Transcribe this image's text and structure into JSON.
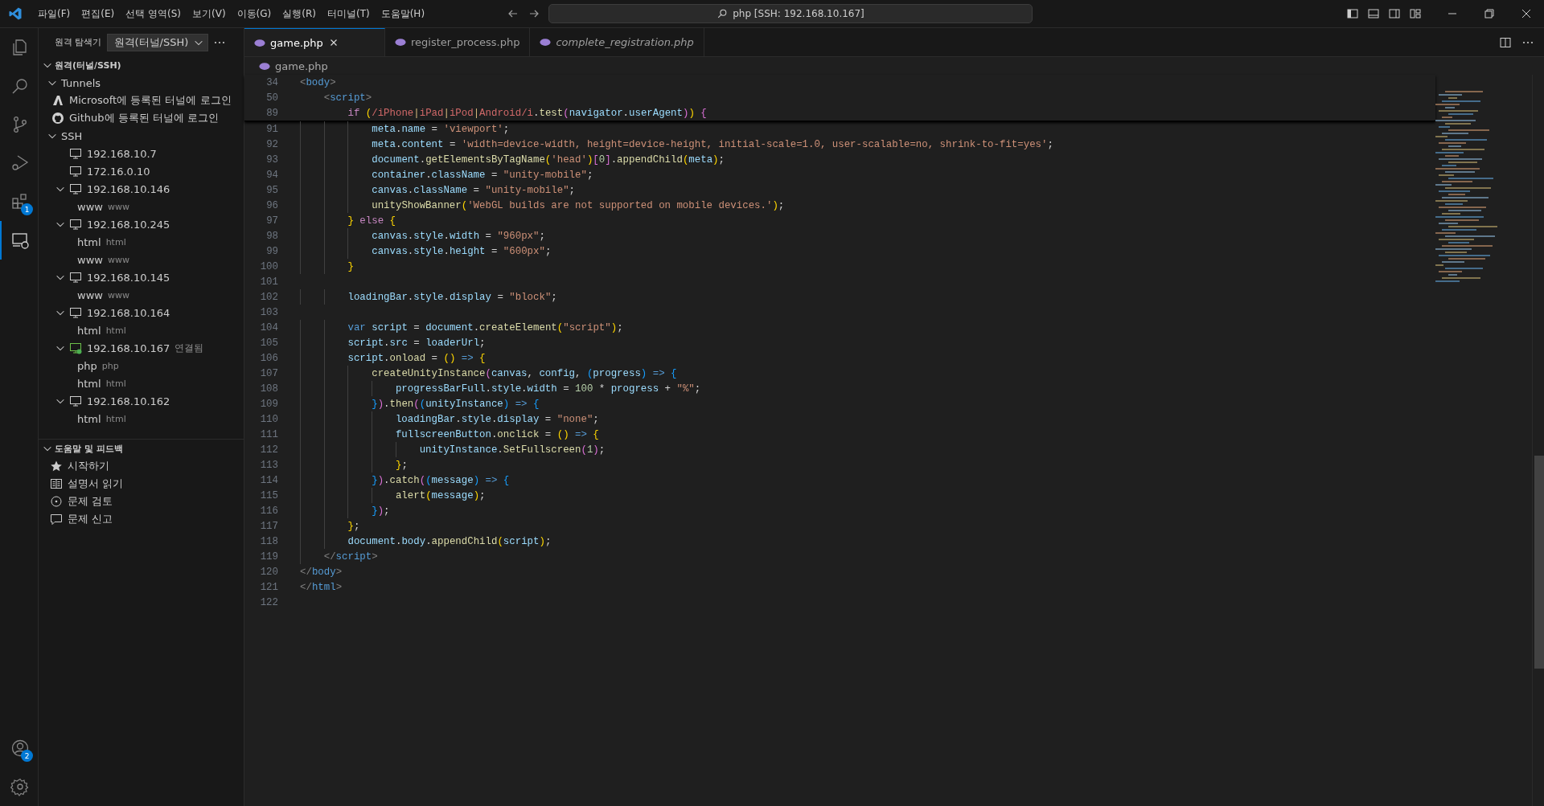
{
  "title_bar": {
    "menus": [
      "파일(F)",
      "편집(E)",
      "선택 영역(S)",
      "보기(V)",
      "이동(G)",
      "실행(R)",
      "터미널(T)",
      "도움말(H)"
    ],
    "search": "php [SSH: 192.168.10.167]"
  },
  "activity_bar": {
    "items": [
      {
        "kind": "explorer",
        "selected": false
      },
      {
        "kind": "search",
        "selected": false
      },
      {
        "kind": "source-control",
        "selected": false
      },
      {
        "kind": "run-debug",
        "selected": false
      },
      {
        "kind": "extensions",
        "selected": false,
        "badge": "1"
      },
      {
        "kind": "remote",
        "selected": true
      }
    ],
    "bottom": [
      {
        "kind": "account",
        "badge": "2"
      },
      {
        "kind": "settings"
      }
    ]
  },
  "sidebar": {
    "title": "원격 탐색기",
    "dropdown": "원격(터널/SSH)",
    "sections": [
      {
        "title": "원격(터널/SSH)",
        "expanded": true,
        "items": [
          {
            "label": "Tunnels",
            "kind": "group",
            "expanded": true,
            "children": [
              {
                "label": "Microsoft에 등록된 터널에 로그인",
                "kind": "microsoft"
              },
              {
                "label": "Github에 등록된 터널에 로그인",
                "kind": "github"
              }
            ]
          },
          {
            "label": "SSH",
            "kind": "group",
            "expanded": true,
            "children": [
              {
                "label": "192.168.10.7",
                "kind": "host",
                "connected": false
              },
              {
                "label": "172.16.0.10",
                "kind": "host",
                "connected": false
              },
              {
                "label": "192.168.10.146",
                "kind": "host",
                "connected": false,
                "expanded": true,
                "children": [
                  {
                    "label": "www",
                    "detail": "www",
                    "kind": "folder"
                  }
                ]
              },
              {
                "label": "192.168.10.245",
                "kind": "host",
                "connected": false,
                "expanded": true,
                "children": [
                  {
                    "label": "html",
                    "detail": "html",
                    "kind": "folder"
                  },
                  {
                    "label": "www",
                    "detail": "www",
                    "kind": "folder"
                  }
                ]
              },
              {
                "label": "192.168.10.145",
                "kind": "host",
                "connected": false,
                "expanded": true,
                "children": [
                  {
                    "label": "www",
                    "detail": "www",
                    "kind": "folder"
                  }
                ]
              },
              {
                "label": "192.168.10.164",
                "kind": "host",
                "connected": false,
                "expanded": true,
                "children": [
                  {
                    "label": "html",
                    "detail": "html",
                    "kind": "folder"
                  }
                ]
              },
              {
                "label": "192.168.10.167",
                "kind": "host",
                "connected": true,
                "status": "연결됨",
                "expanded": true,
                "children": [
                  {
                    "label": "php",
                    "detail": "php",
                    "kind": "folder"
                  },
                  {
                    "label": "html",
                    "detail": "html",
                    "kind": "folder"
                  }
                ]
              },
              {
                "label": "192.168.10.162",
                "kind": "host",
                "connected": false,
                "expanded": true,
                "children": [
                  {
                    "label": "html",
                    "detail": "html",
                    "kind": "folder"
                  }
                ]
              }
            ]
          }
        ]
      },
      {
        "title": "도움말 및 피드백",
        "expanded": true,
        "items": [
          {
            "label": "시작하기",
            "kind": "star"
          },
          {
            "label": "설명서 읽기",
            "kind": "book"
          },
          {
            "label": "문제 검토",
            "kind": "issues"
          },
          {
            "label": "문제 신고",
            "kind": "comment"
          }
        ]
      }
    ]
  },
  "tabs": [
    {
      "label": "game.php",
      "selected": true,
      "preview": false
    },
    {
      "label": "register_process.php",
      "selected": false,
      "preview": false
    },
    {
      "label": "complete_registration.php",
      "selected": false,
      "preview": true
    }
  ],
  "breadcrumb": "game.php",
  "editor": {
    "sticky_lines": [
      {
        "n": "34",
        "tokens": [
          {
            "text": "<",
            "kind": "tp"
          },
          {
            "text": "body",
            "kind": "tag"
          },
          {
            "text": ">",
            "kind": "tp"
          }
        ]
      },
      {
        "n": "50",
        "tokens": [
          {
            "text": "    <",
            "kind": "tp"
          },
          {
            "text": "script",
            "kind": "tag"
          },
          {
            "text": ">",
            "kind": "tp"
          }
        ]
      },
      {
        "n": "89",
        "tokens": [
          {
            "text": "        if ",
            "kind": "ctrl"
          },
          {
            "text": "(",
            "kind": "b1"
          },
          {
            "text": "/iPhone",
            "kind": "rx"
          },
          {
            "text": "|",
            "kind": "rxop"
          },
          {
            "text": "iPad",
            "kind": "rx"
          },
          {
            "text": "|",
            "kind": "rxop"
          },
          {
            "text": "iPod",
            "kind": "rx"
          },
          {
            "text": "|",
            "kind": "rxop"
          },
          {
            "text": "Android/i",
            "kind": "rx"
          },
          {
            "text": ".",
            "kind": "p"
          },
          {
            "text": "test",
            "kind": "fn"
          },
          {
            "text": "(",
            "kind": "b2"
          },
          {
            "text": "navigator",
            "kind": "var"
          },
          {
            "text": ".",
            "kind": "p"
          },
          {
            "text": "userAgent",
            "kind": "var"
          },
          {
            "text": ")",
            "kind": "b2"
          },
          {
            "text": ") ",
            "kind": "b1"
          },
          {
            "text": "{",
            "kind": "b2"
          }
        ]
      }
    ],
    "lines": [
      {
        "n": "91",
        "tokens": [
          {
            "text": "            meta",
            "kind": "var"
          },
          {
            "text": ".",
            "kind": "p"
          },
          {
            "text": "name",
            "kind": "var"
          },
          {
            "text": " = ",
            "kind": "p"
          },
          {
            "text": "'viewport'",
            "kind": "str"
          },
          {
            "text": ";",
            "kind": "p"
          }
        ]
      },
      {
        "n": "92",
        "tokens": [
          {
            "text": "            meta",
            "kind": "var"
          },
          {
            "text": ".",
            "kind": "p"
          },
          {
            "text": "content",
            "kind": "var"
          },
          {
            "text": " = ",
            "kind": "p"
          },
          {
            "text": "'width=device-width, height=device-height, initial-scale=1.0, user-scalable=no, shrink-to-fit=yes'",
            "kind": "str"
          },
          {
            "text": ";",
            "kind": "p"
          }
        ]
      },
      {
        "n": "93",
        "tokens": [
          {
            "text": "            document",
            "kind": "var"
          },
          {
            "text": ".",
            "kind": "p"
          },
          {
            "text": "getElementsByTagName",
            "kind": "fn"
          },
          {
            "text": "(",
            "kind": "b1"
          },
          {
            "text": "'head'",
            "kind": "str"
          },
          {
            "text": ")",
            "kind": "b1"
          },
          {
            "text": "[",
            "kind": "b2"
          },
          {
            "text": "0",
            "kind": "num"
          },
          {
            "text": "]",
            "kind": "b2"
          },
          {
            "text": ".",
            "kind": "p"
          },
          {
            "text": "appendChild",
            "kind": "fn"
          },
          {
            "text": "(",
            "kind": "b1"
          },
          {
            "text": "meta",
            "kind": "var"
          },
          {
            "text": ")",
            "kind": "b1"
          },
          {
            "text": ";",
            "kind": "p"
          }
        ]
      },
      {
        "n": "94",
        "tokens": [
          {
            "text": "            container",
            "kind": "var"
          },
          {
            "text": ".",
            "kind": "p"
          },
          {
            "text": "className",
            "kind": "var"
          },
          {
            "text": " = ",
            "kind": "p"
          },
          {
            "text": "\"unity-mobile\"",
            "kind": "str"
          },
          {
            "text": ";",
            "kind": "p"
          }
        ]
      },
      {
        "n": "95",
        "tokens": [
          {
            "text": "            canvas",
            "kind": "var"
          },
          {
            "text": ".",
            "kind": "p"
          },
          {
            "text": "className",
            "kind": "var"
          },
          {
            "text": " = ",
            "kind": "p"
          },
          {
            "text": "\"unity-mobile\"",
            "kind": "str"
          },
          {
            "text": ";",
            "kind": "p"
          }
        ]
      },
      {
        "n": "96",
        "tokens": [
          {
            "text": "            unityShowBanner",
            "kind": "fn"
          },
          {
            "text": "(",
            "kind": "b1"
          },
          {
            "text": "'WebGL builds are not supported on mobile devices.'",
            "kind": "str"
          },
          {
            "text": ")",
            "kind": "b1"
          },
          {
            "text": ";",
            "kind": "p"
          }
        ]
      },
      {
        "n": "97",
        "tokens": [
          {
            "text": "        }",
            "kind": "b1"
          },
          {
            "text": " else ",
            "kind": "ctrl"
          },
          {
            "text": "{",
            "kind": "b1"
          }
        ]
      },
      {
        "n": "98",
        "tokens": [
          {
            "text": "            canvas",
            "kind": "var"
          },
          {
            "text": ".",
            "kind": "p"
          },
          {
            "text": "style",
            "kind": "var"
          },
          {
            "text": ".",
            "kind": "p"
          },
          {
            "text": "width",
            "kind": "var"
          },
          {
            "text": " = ",
            "kind": "p"
          },
          {
            "text": "\"960px\"",
            "kind": "str"
          },
          {
            "text": ";",
            "kind": "p"
          }
        ]
      },
      {
        "n": "99",
        "tokens": [
          {
            "text": "            canvas",
            "kind": "var"
          },
          {
            "text": ".",
            "kind": "p"
          },
          {
            "text": "style",
            "kind": "var"
          },
          {
            "text": ".",
            "kind": "p"
          },
          {
            "text": "height",
            "kind": "var"
          },
          {
            "text": " = ",
            "kind": "p"
          },
          {
            "text": "\"600px\"",
            "kind": "str"
          },
          {
            "text": ";",
            "kind": "p"
          }
        ]
      },
      {
        "n": "100",
        "tokens": [
          {
            "text": "        }",
            "kind": "b1"
          }
        ]
      },
      {
        "n": "101"
      },
      {
        "n": "102",
        "tokens": [
          {
            "text": "        loadingBar",
            "kind": "var"
          },
          {
            "text": ".",
            "kind": "p"
          },
          {
            "text": "style",
            "kind": "var"
          },
          {
            "text": ".",
            "kind": "p"
          },
          {
            "text": "display",
            "kind": "var"
          },
          {
            "text": " = ",
            "kind": "p"
          },
          {
            "text": "\"block\"",
            "kind": "str"
          },
          {
            "text": ";",
            "kind": "p"
          }
        ]
      },
      {
        "n": "103"
      },
      {
        "n": "104",
        "tokens": [
          {
            "text": "        var ",
            "kind": "kw"
          },
          {
            "text": "script",
            "kind": "var"
          },
          {
            "text": " = ",
            "kind": "p"
          },
          {
            "text": "document",
            "kind": "var"
          },
          {
            "text": ".",
            "kind": "p"
          },
          {
            "text": "createElement",
            "kind": "fn"
          },
          {
            "text": "(",
            "kind": "b1"
          },
          {
            "text": "\"script\"",
            "kind": "str"
          },
          {
            "text": ")",
            "kind": "b1"
          },
          {
            "text": ";",
            "kind": "p"
          }
        ]
      },
      {
        "n": "105",
        "tokens": [
          {
            "text": "        script",
            "kind": "var"
          },
          {
            "text": ".",
            "kind": "p"
          },
          {
            "text": "src",
            "kind": "var"
          },
          {
            "text": " = ",
            "kind": "p"
          },
          {
            "text": "loaderUrl",
            "kind": "var"
          },
          {
            "text": ";",
            "kind": "p"
          }
        ]
      },
      {
        "n": "106",
        "tokens": [
          {
            "text": "        script",
            "kind": "var"
          },
          {
            "text": ".",
            "kind": "p"
          },
          {
            "text": "onload",
            "kind": "fn"
          },
          {
            "text": " = ",
            "kind": "p"
          },
          {
            "text": "() ",
            "kind": "b1"
          },
          {
            "text": "=> ",
            "kind": "kw"
          },
          {
            "text": "{",
            "kind": "b1"
          }
        ]
      },
      {
        "n": "107",
        "tokens": [
          {
            "text": "            createUnityInstance",
            "kind": "fn"
          },
          {
            "text": "(",
            "kind": "b2"
          },
          {
            "text": "canvas",
            "kind": "var"
          },
          {
            "text": ", ",
            "kind": "p"
          },
          {
            "text": "config",
            "kind": "var"
          },
          {
            "text": ", ",
            "kind": "p"
          },
          {
            "text": "(",
            "kind": "b3"
          },
          {
            "text": "progress",
            "kind": "var"
          },
          {
            "text": ") ",
            "kind": "b3"
          },
          {
            "text": "=> ",
            "kind": "kw"
          },
          {
            "text": "{",
            "kind": "b3"
          }
        ]
      },
      {
        "n": "108",
        "tokens": [
          {
            "text": "                progressBarFull",
            "kind": "var"
          },
          {
            "text": ".",
            "kind": "p"
          },
          {
            "text": "style",
            "kind": "var"
          },
          {
            "text": ".",
            "kind": "p"
          },
          {
            "text": "width",
            "kind": "var"
          },
          {
            "text": " = ",
            "kind": "p"
          },
          {
            "text": "100",
            "kind": "num"
          },
          {
            "text": " * ",
            "kind": "p"
          },
          {
            "text": "progress",
            "kind": "var"
          },
          {
            "text": " + ",
            "kind": "p"
          },
          {
            "text": "\"%\"",
            "kind": "str"
          },
          {
            "text": ";",
            "kind": "p"
          }
        ]
      },
      {
        "n": "109",
        "tokens": [
          {
            "text": "            }",
            "kind": "b3"
          },
          {
            "text": ")",
            "kind": "b2"
          },
          {
            "text": ".",
            "kind": "p"
          },
          {
            "text": "then",
            "kind": "fn"
          },
          {
            "text": "(",
            "kind": "b2"
          },
          {
            "text": "(",
            "kind": "b3"
          },
          {
            "text": "unityInstance",
            "kind": "var"
          },
          {
            "text": ") ",
            "kind": "b3"
          },
          {
            "text": "=> ",
            "kind": "kw"
          },
          {
            "text": "{",
            "kind": "b3"
          }
        ]
      },
      {
        "n": "110",
        "tokens": [
          {
            "text": "                loadingBar",
            "kind": "var"
          },
          {
            "text": ".",
            "kind": "p"
          },
          {
            "text": "style",
            "kind": "var"
          },
          {
            "text": ".",
            "kind": "p"
          },
          {
            "text": "display",
            "kind": "var"
          },
          {
            "text": " = ",
            "kind": "p"
          },
          {
            "text": "\"none\"",
            "kind": "str"
          },
          {
            "text": ";",
            "kind": "p"
          }
        ]
      },
      {
        "n": "111",
        "tokens": [
          {
            "text": "                fullscreenButton",
            "kind": "var"
          },
          {
            "text": ".",
            "kind": "p"
          },
          {
            "text": "onclick",
            "kind": "fn"
          },
          {
            "text": " = ",
            "kind": "p"
          },
          {
            "text": "() ",
            "kind": "b1"
          },
          {
            "text": "=> ",
            "kind": "kw"
          },
          {
            "text": "{",
            "kind": "b1"
          }
        ]
      },
      {
        "n": "112",
        "tokens": [
          {
            "text": "                    unityInstance",
            "kind": "var"
          },
          {
            "text": ".",
            "kind": "p"
          },
          {
            "text": "SetFullscreen",
            "kind": "fn"
          },
          {
            "text": "(",
            "kind": "b2"
          },
          {
            "text": "1",
            "kind": "num"
          },
          {
            "text": ")",
            "kind": "b2"
          },
          {
            "text": ";",
            "kind": "p"
          }
        ]
      },
      {
        "n": "113",
        "tokens": [
          {
            "text": "                }",
            "kind": "b1"
          },
          {
            "text": ";",
            "kind": "p"
          }
        ]
      },
      {
        "n": "114",
        "tokens": [
          {
            "text": "            }",
            "kind": "b3"
          },
          {
            "text": ")",
            "kind": "b2"
          },
          {
            "text": ".",
            "kind": "p"
          },
          {
            "text": "catch",
            "kind": "fn"
          },
          {
            "text": "(",
            "kind": "b2"
          },
          {
            "text": "(",
            "kind": "b3"
          },
          {
            "text": "message",
            "kind": "var"
          },
          {
            "text": ") ",
            "kind": "b3"
          },
          {
            "text": "=> ",
            "kind": "kw"
          },
          {
            "text": "{",
            "kind": "b3"
          }
        ]
      },
      {
        "n": "115",
        "tokens": [
          {
            "text": "                alert",
            "kind": "fn"
          },
          {
            "text": "(",
            "kind": "b1"
          },
          {
            "text": "message",
            "kind": "var"
          },
          {
            "text": ")",
            "kind": "b1"
          },
          {
            "text": ";",
            "kind": "p"
          }
        ]
      },
      {
        "n": "116",
        "tokens": [
          {
            "text": "            }",
            "kind": "b3"
          },
          {
            "text": ")",
            "kind": "b2"
          },
          {
            "text": ";",
            "kind": "p"
          }
        ]
      },
      {
        "n": "117",
        "tokens": [
          {
            "text": "        }",
            "kind": "b1"
          },
          {
            "text": ";",
            "kind": "p"
          }
        ]
      },
      {
        "n": "118",
        "tokens": [
          {
            "text": "        document",
            "kind": "var"
          },
          {
            "text": ".",
            "kind": "p"
          },
          {
            "text": "body",
            "kind": "var"
          },
          {
            "text": ".",
            "kind": "p"
          },
          {
            "text": "appendChild",
            "kind": "fn"
          },
          {
            "text": "(",
            "kind": "b1"
          },
          {
            "text": "script",
            "kind": "var"
          },
          {
            "text": ")",
            "kind": "b1"
          },
          {
            "text": ";",
            "kind": "p"
          }
        ]
      },
      {
        "n": "119",
        "tokens": [
          {
            "text": "    </",
            "kind": "tp"
          },
          {
            "text": "script",
            "kind": "tag"
          },
          {
            "text": ">",
            "kind": "tp"
          }
        ]
      },
      {
        "n": "120",
        "tokens": [
          {
            "text": "</",
            "kind": "tp"
          },
          {
            "text": "body",
            "kind": "tag"
          },
          {
            "text": ">",
            "kind": "tp"
          }
        ]
      },
      {
        "n": "121",
        "tokens": [
          {
            "text": "</",
            "kind": "tp"
          },
          {
            "text": "html",
            "kind": "tag"
          },
          {
            "text": ">",
            "kind": "tp"
          }
        ]
      },
      {
        "n": "122"
      }
    ]
  }
}
